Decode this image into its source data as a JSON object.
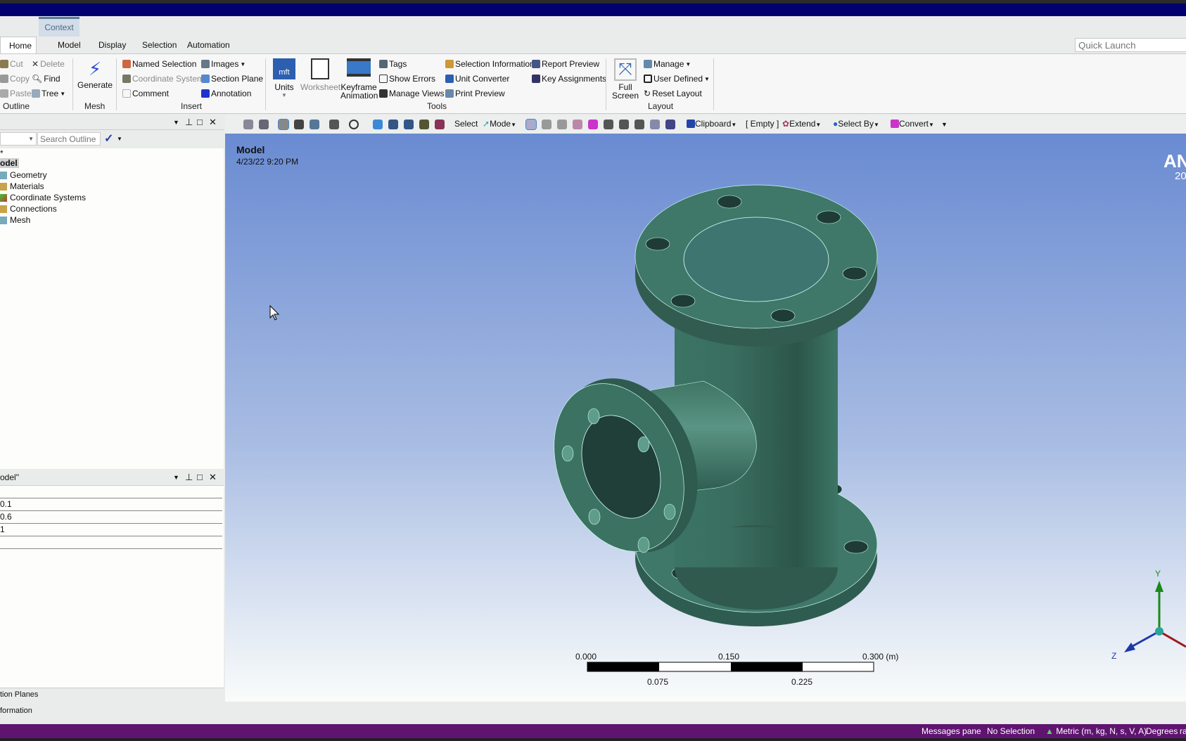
{
  "ribbon": {
    "context_tab": "Context",
    "tabs": [
      "Home",
      "Model",
      "Display",
      "Selection",
      "Automation"
    ],
    "quick_launch_placeholder": "Quick Launch",
    "outline": {
      "cut": "Cut",
      "copy": "Copy",
      "paste": "Paste",
      "delete": "Delete",
      "find": "Find",
      "tree": "Tree",
      "label": "Outline"
    },
    "mesh": {
      "generate": "Generate",
      "label": "Mesh"
    },
    "insert": {
      "named_selection": "Named Selection",
      "coordinate_system": "Coordinate System",
      "comment": "Comment",
      "images": "Images",
      "section_plane": "Section Plane",
      "annotation": "Annotation",
      "label": "Insert"
    },
    "tools": {
      "units": "Units",
      "worksheet": "Worksheet",
      "keyframe1": "Keyframe",
      "keyframe2": "Animation",
      "tags": "Tags",
      "show_errors": "Show Errors",
      "manage_views": "Manage Views",
      "selection_information": "Selection Information",
      "unit_converter": "Unit Converter",
      "print_preview": "Print Preview",
      "report_preview": "Report Preview",
      "key_assignments": "Key Assignments",
      "label": "Tools"
    },
    "layout": {
      "full1": "Full",
      "full2": "Screen",
      "manage": "Manage",
      "user_defined": "User Defined",
      "reset_layout": "Reset Layout",
      "label": "Layout"
    }
  },
  "toolbar": {
    "select": "Select",
    "mode": "Mode",
    "clipboard": "Clipboard",
    "empty": "[ Empty ]",
    "extend": "Extend",
    "select_by": "Select By",
    "convert": "Convert"
  },
  "outline": {
    "search_placeholder": "Search Outline",
    "root_star": "*",
    "root": "odel",
    "items": [
      "Geometry",
      "Materials",
      "Coordinate Systems",
      "Connections",
      "Mesh"
    ]
  },
  "details": {
    "title": "odel\"",
    "rows": [
      "",
      "0.1",
      "0.6",
      "1",
      ""
    ]
  },
  "bottom_tabs": [
    "tion Planes",
    "formation"
  ],
  "viewport": {
    "title": "Model",
    "date": "4/23/22 9:20 PM",
    "logo_text": "AN",
    "logo_sub": "20",
    "scale": {
      "top_labels": [
        "0.000",
        "0.150",
        "0.300 (m)"
      ],
      "bottom_labels": [
        "0.075",
        "0.225"
      ]
    },
    "triad": {
      "y": "Y",
      "z": "Z"
    },
    "model_color": "#3f7a6a"
  },
  "status": {
    "messages": "Messages pane",
    "selection": "No Selection",
    "units": "Metric (m, kg, N, s, V, A)",
    "angle": "Degrees",
    "extra": "ra"
  }
}
